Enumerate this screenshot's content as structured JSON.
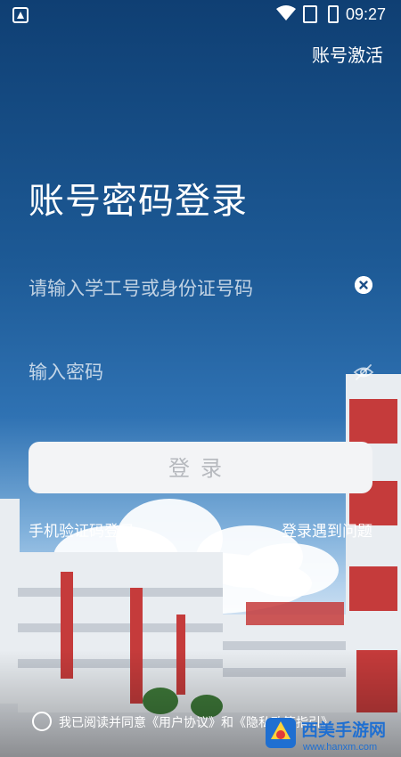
{
  "status_bar": {
    "time": "09:27"
  },
  "header": {
    "activate_label": "账号激活"
  },
  "main": {
    "title": "账号密码登录",
    "username_placeholder": "请输入学工号或身份证号码",
    "password_placeholder": "输入密码",
    "login_label": "登录",
    "sms_login_label": "手机验证码登录",
    "problem_label": "登录遇到问题"
  },
  "agreement": {
    "prefix": "我已阅读并同意",
    "user_agreement": "《用户协议》",
    "and": "和",
    "privacy_policy": "《隐私政策指引》"
  },
  "watermark": {
    "brand": "西美手游网",
    "url": "www.hanxm.com"
  },
  "colors": {
    "accent": "#ffffff",
    "button_bg": "#f3f4f6",
    "button_text": "#b6b9be"
  }
}
